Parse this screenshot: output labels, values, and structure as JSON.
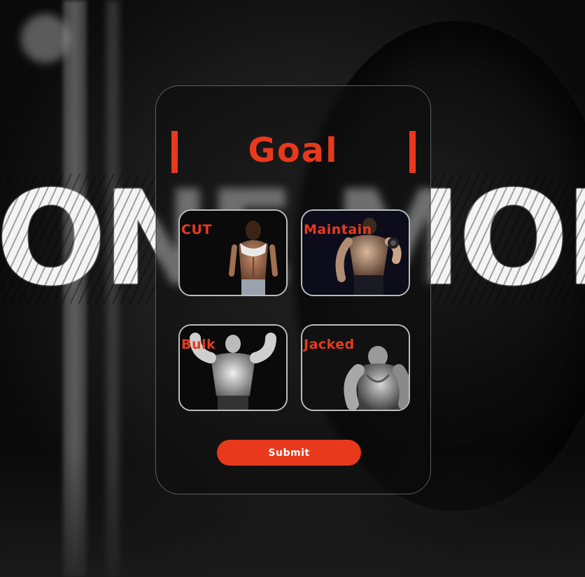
{
  "background": {
    "word": "ONE MORE"
  },
  "card": {
    "title": "Goal",
    "options": [
      {
        "id": "cut",
        "label": "CUT"
      },
      {
        "id": "maintain",
        "label": "Maintain"
      },
      {
        "id": "bulk",
        "label": "Bulk"
      },
      {
        "id": "jacked",
        "label": "Jacked"
      }
    ],
    "submit_label": "Submit"
  },
  "colors": {
    "accent": "#e8391d",
    "card_border": "#bdbdbd",
    "button_text": "#ffffff"
  }
}
